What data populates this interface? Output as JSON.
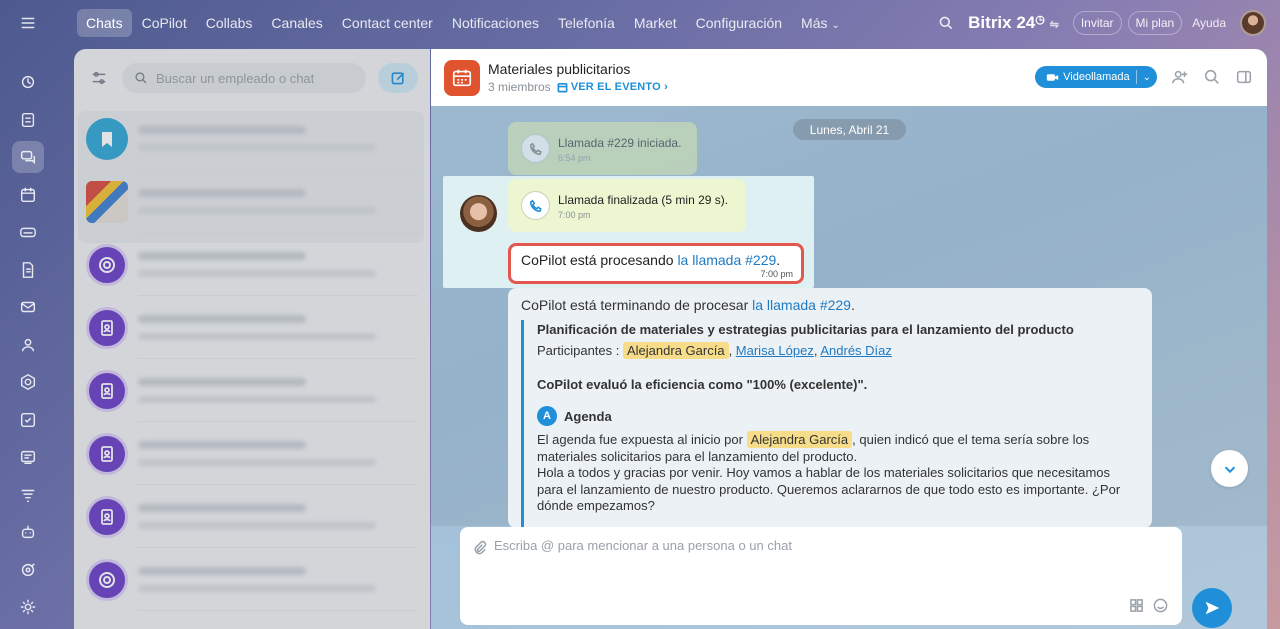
{
  "nav": {
    "items": [
      "Chats",
      "CoPilot",
      "Collabs",
      "Canales",
      "Contact center",
      "Notificaciones",
      "Telefonía",
      "Market",
      "Configuración",
      "Más"
    ],
    "active_index": 0
  },
  "brand": "Bitrix 24",
  "top_buttons": {
    "invite": "Invitar",
    "my_plan": "Mi plan",
    "help": "Ayuda"
  },
  "rail_icons": [
    "menu-icon",
    "activity-icon",
    "tasks-icon",
    "chat-icon",
    "calendar-icon",
    "drive-icon",
    "docs-icon",
    "mail-icon",
    "contacts-icon",
    "hexagon-icon",
    "checklist-icon",
    "cards-icon",
    "filter-icon",
    "robot-icon",
    "goal-icon",
    "settings-icon"
  ],
  "search": {
    "placeholder": "Buscar un empleado o chat"
  },
  "chat_list": [
    {
      "avatar": "bookmark"
    },
    {
      "avatar": "photo"
    },
    {
      "avatar": "copilot"
    },
    {
      "avatar": "contact"
    },
    {
      "avatar": "contact"
    },
    {
      "avatar": "contact"
    },
    {
      "avatar": "contact"
    },
    {
      "avatar": "copilot"
    }
  ],
  "dialog": {
    "title": "Materiales publicitarios",
    "members": "3 miembros",
    "event_link": "VER EL EVENTO",
    "video_call": "Videollamada",
    "date_divider": "Lunes, Abril 21",
    "call_started": {
      "text": "Llamada #229 iniciada.",
      "time": "6:54 pm"
    },
    "call_ended": {
      "text": "Llamada finalizada (5 min 29 s).",
      "time": "7:00 pm"
    },
    "processing": {
      "prefix": "CoPilot está procesando ",
      "link": "la llamada #229",
      "suffix": ".",
      "time": "7:00 pm"
    },
    "summary": {
      "head_prefix": "CoPilot está terminando de procesar ",
      "head_link": "la llamada #229",
      "head_suffix": ".",
      "title": "Planificación de materiales y estrategias publicitarias para el lanzamiento del producto",
      "participants_label": "Participantes :",
      "participants": [
        "Alejandra García",
        "Marisa López",
        "Andrés Díaz"
      ],
      "evaluation": "CoPilot evaluó la eficiencia como \"100% (excelente)\".",
      "agenda_icon": "A",
      "agenda_title": "Agenda",
      "agenda_p1_a": "El agenda fue expuesta al inicio por ",
      "agenda_p1_tag": "Alejandra García",
      "agenda_p1_b": ", quien indicó que el tema sería sobre los materiales solicitarios para el lanzamiento del producto.",
      "agenda_p2": "Hola a todos y gracias por venir. Hoy vamos a hablar de los materiales solicitarios que necesitamos para el lanzamiento de nuestro producto. Queremos aclararnos de que todo esto es importante. ¿Por dónde empezamos?"
    },
    "composer_placeholder": "Escriba @ para mencionar a una persona o un chat"
  },
  "colors": {
    "accent": "#1e8fd8",
    "highlight_border": "#e4574e",
    "tag": "#f7dd8a"
  }
}
